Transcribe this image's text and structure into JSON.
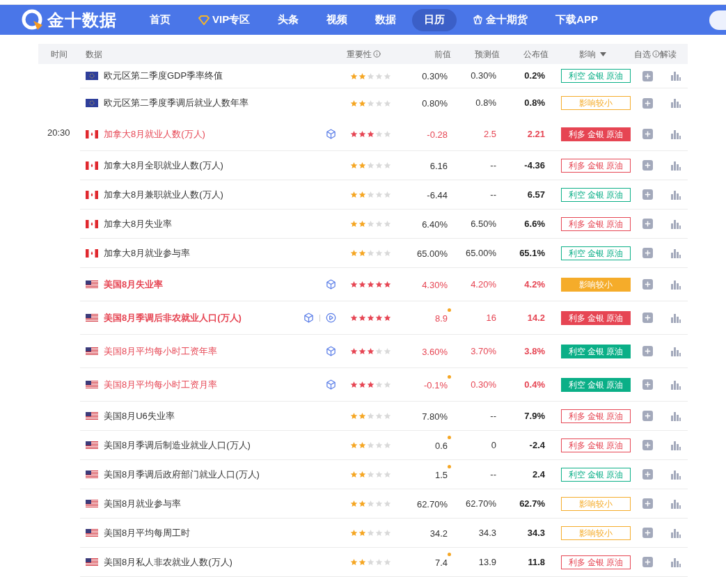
{
  "nav": {
    "logo": "金十数据",
    "items": [
      {
        "label": "首页",
        "selected": false
      },
      {
        "label": "VIP专区",
        "selected": false
      },
      {
        "label": "头条",
        "selected": false
      },
      {
        "label": "视频",
        "selected": false
      },
      {
        "label": "数据",
        "selected": false
      },
      {
        "label": "日历",
        "selected": true
      },
      {
        "label": "金十期货",
        "selected": false
      },
      {
        "label": "下载APP",
        "selected": false
      }
    ]
  },
  "table": {
    "columns": [
      "时间",
      "数据",
      "重要性",
      "前值",
      "预测值",
      "公布值",
      "影响",
      "自选",
      "解读"
    ],
    "rows": [
      {
        "kind": "eu",
        "name": "欧元区第二季度GDP季率终值",
        "important": false,
        "bold": false,
        "cube": false,
        "video": false,
        "stars": 2,
        "previous": "0.30%",
        "previous_revised": false,
        "forecast": "0.30%",
        "actual": "0.2%",
        "impact": {
          "text": "利空 金银 原油",
          "kind": "bearish",
          "solid": false
        }
      },
      {
        "kind": "eu",
        "name": "欧元区第二季度季调后就业人数年率",
        "important": false,
        "bold": false,
        "cube": false,
        "video": false,
        "stars": 2,
        "previous": "0.80%",
        "previous_revised": false,
        "forecast": "0.8%",
        "actual": "0.8%",
        "impact": {
          "text": "影响较小",
          "kind": "minor",
          "solid": false
        }
      },
      {
        "time": "20:30",
        "kind": "ca",
        "name": "加拿大8月就业人数(万人)",
        "important": true,
        "bold": false,
        "cube": true,
        "video": false,
        "stars": 3,
        "previous": "-0.28",
        "previous_revised": false,
        "forecast": "2.5",
        "actual": "2.21",
        "impact": {
          "text": "利多 金银 原油",
          "kind": "bullish",
          "solid": true
        }
      },
      {
        "kind": "ca",
        "name": "加拿大8月全职就业人数(万人)",
        "important": false,
        "bold": false,
        "cube": false,
        "video": false,
        "stars": 2,
        "previous": "6.16",
        "previous_revised": false,
        "forecast": "--",
        "actual": "-4.36",
        "impact": {
          "text": "利多 金银 原油",
          "kind": "bullish",
          "solid": false
        }
      },
      {
        "kind": "ca",
        "name": "加拿大8月兼职就业人数(万人)",
        "important": false,
        "bold": false,
        "cube": false,
        "video": false,
        "stars": 2,
        "previous": "-6.44",
        "previous_revised": false,
        "forecast": "--",
        "actual": "6.57",
        "impact": {
          "text": "利空 金银 原油",
          "kind": "bearish",
          "solid": false
        }
      },
      {
        "kind": "ca",
        "name": "加拿大8月失业率",
        "important": false,
        "bold": false,
        "cube": false,
        "video": false,
        "stars": 2,
        "previous": "6.40%",
        "previous_revised": false,
        "forecast": "6.50%",
        "actual": "6.6%",
        "impact": {
          "text": "利多 金银 原油",
          "kind": "bullish",
          "solid": false
        }
      },
      {
        "kind": "ca",
        "name": "加拿大8月就业参与率",
        "important": false,
        "bold": false,
        "cube": false,
        "video": false,
        "stars": 2,
        "previous": "65.00%",
        "previous_revised": false,
        "forecast": "65.00%",
        "actual": "65.1%",
        "impact": {
          "text": "利空 金银 原油",
          "kind": "bearish",
          "solid": false
        }
      },
      {
        "kind": "us",
        "name": "美国8月失业率",
        "important": true,
        "bold": true,
        "cube": true,
        "video": false,
        "stars": 5,
        "previous": "4.30%",
        "previous_revised": false,
        "forecast": "4.20%",
        "actual": "4.2%",
        "impact": {
          "text": "影响较小",
          "kind": "minor",
          "solid": true
        }
      },
      {
        "kind": "us",
        "name": "美国8月季调后非农就业人口(万人)",
        "important": true,
        "bold": true,
        "cube": true,
        "video": true,
        "stars": 5,
        "previous": "8.9",
        "previous_revised": true,
        "forecast": "16",
        "actual": "14.2",
        "impact": {
          "text": "利多 金银 原油",
          "kind": "bullish",
          "solid": true
        }
      },
      {
        "kind": "us",
        "name": "美国8月平均每小时工资年率",
        "important": true,
        "bold": false,
        "cube": true,
        "video": false,
        "stars": 3,
        "previous": "3.60%",
        "previous_revised": false,
        "forecast": "3.70%",
        "actual": "3.8%",
        "impact": {
          "text": "利空 金银 原油",
          "kind": "bearish",
          "solid": true
        }
      },
      {
        "kind": "us",
        "name": "美国8月平均每小时工资月率",
        "important": true,
        "bold": false,
        "cube": true,
        "video": false,
        "stars": 3,
        "previous": "-0.1%",
        "previous_revised": true,
        "forecast": "0.30%",
        "actual": "0.4%",
        "impact": {
          "text": "利空 金银 原油",
          "kind": "bearish",
          "solid": true
        }
      },
      {
        "kind": "us",
        "name": "美国8月U6失业率",
        "important": false,
        "bold": false,
        "cube": false,
        "video": false,
        "stars": 2,
        "previous": "7.80%",
        "previous_revised": false,
        "forecast": "--",
        "actual": "7.9%",
        "impact": {
          "text": "利多 金银 原油",
          "kind": "bullish",
          "solid": false
        }
      },
      {
        "kind": "us",
        "name": "美国8月季调后制造业就业人口(万人)",
        "important": false,
        "bold": false,
        "cube": false,
        "video": false,
        "stars": 2,
        "previous": "0.6",
        "previous_revised": true,
        "forecast": "0",
        "actual": "-2.4",
        "impact": {
          "text": "利多 金银 原油",
          "kind": "bullish",
          "solid": false
        }
      },
      {
        "kind": "us",
        "name": "美国8月季调后政府部门就业人口(万人)",
        "important": false,
        "bold": false,
        "cube": false,
        "video": false,
        "stars": 2,
        "previous": "1.5",
        "previous_revised": true,
        "forecast": "--",
        "actual": "2.4",
        "impact": {
          "text": "利空 金银 原油",
          "kind": "bearish",
          "solid": false
        }
      },
      {
        "kind": "us",
        "name": "美国8月就业参与率",
        "important": false,
        "bold": false,
        "cube": false,
        "video": false,
        "stars": 2,
        "previous": "62.70%",
        "previous_revised": false,
        "forecast": "62.70%",
        "actual": "62.7%",
        "impact": {
          "text": "影响较小",
          "kind": "minor",
          "solid": false
        }
      },
      {
        "kind": "us",
        "name": "美国8月平均每周工时",
        "important": false,
        "bold": false,
        "cube": false,
        "video": false,
        "stars": 2,
        "previous": "34.2",
        "previous_revised": false,
        "forecast": "34.3",
        "actual": "34.3",
        "impact": {
          "text": "影响较小",
          "kind": "minor",
          "solid": false
        }
      },
      {
        "kind": "us",
        "name": "美国8月私人非农就业人数(万人)",
        "important": false,
        "bold": false,
        "cube": false,
        "video": false,
        "stars": 2,
        "previous": "7.4",
        "previous_revised": true,
        "forecast": "13.9",
        "actual": "11.8",
        "impact": {
          "text": "利多 金银 原油",
          "kind": "bullish",
          "solid": false
        }
      }
    ]
  }
}
